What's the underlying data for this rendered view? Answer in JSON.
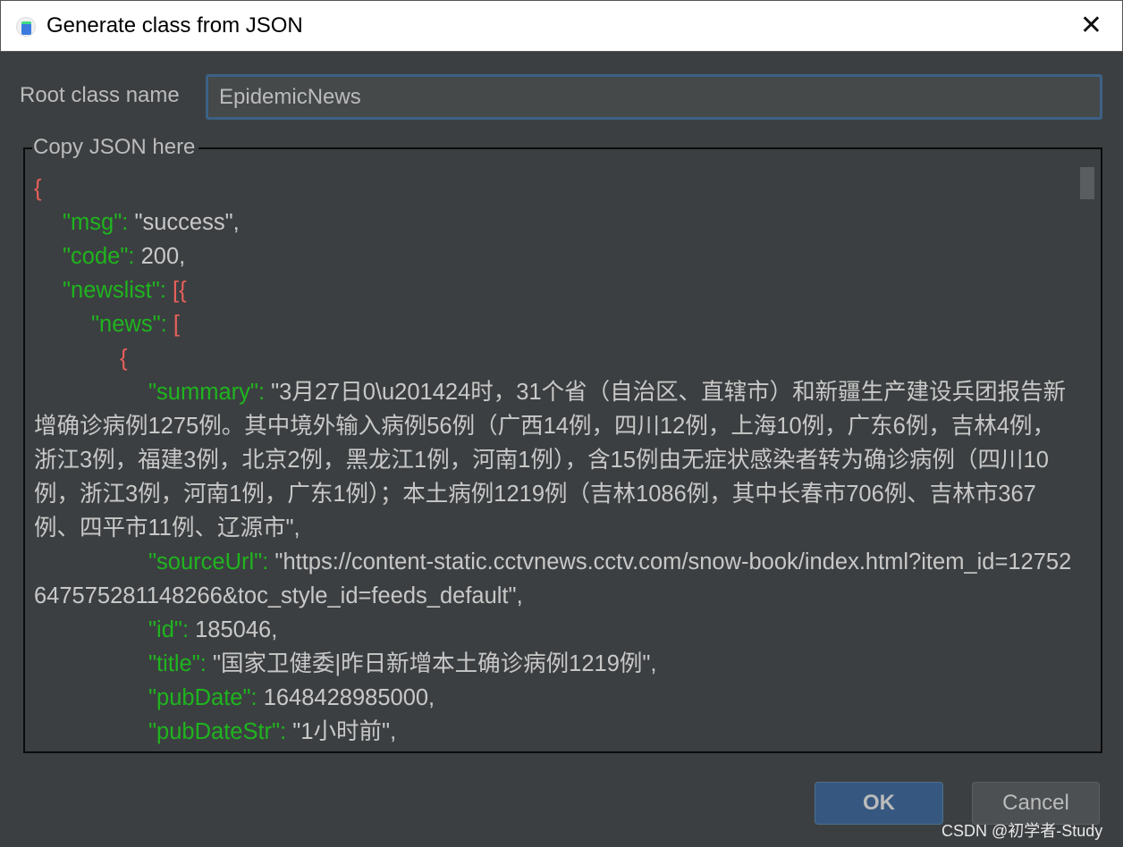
{
  "window": {
    "title": "Generate class from JSON"
  },
  "form": {
    "root_label": "Root class name",
    "root_value": "EpidemicNews",
    "json_label": "Copy JSON here"
  },
  "editor_lines": [
    {
      "indent": 0,
      "tokens": [
        {
          "t": "{",
          "c": "p"
        }
      ]
    },
    {
      "indent": 1,
      "tokens": [
        {
          "t": "\"msg\"",
          "c": "k"
        },
        {
          "t": ": ",
          "c": "k"
        },
        {
          "t": "\"success\",",
          "c": "v"
        }
      ]
    },
    {
      "indent": 1,
      "tokens": [
        {
          "t": "\"code\"",
          "c": "k"
        },
        {
          "t": ": ",
          "c": "k"
        },
        {
          "t": "200,",
          "c": "v"
        }
      ]
    },
    {
      "indent": 1,
      "tokens": [
        {
          "t": "\"newslist\"",
          "c": "k"
        },
        {
          "t": ": ",
          "c": "k"
        },
        {
          "t": "[{",
          "c": "p"
        }
      ]
    },
    {
      "indent": 2,
      "tokens": [
        {
          "t": "\"news\"",
          "c": "k"
        },
        {
          "t": ": ",
          "c": "k"
        },
        {
          "t": "[",
          "c": "p"
        }
      ]
    },
    {
      "indent": 3,
      "tokens": [
        {
          "t": "{",
          "c": "p"
        }
      ]
    },
    {
      "indent": 4,
      "tokens": [
        {
          "t": "\"summary\"",
          "c": "k"
        },
        {
          "t": ": ",
          "c": "k"
        },
        {
          "t": "\"3月27日0\\u201424时，31个省（自治区、直辖市）和新疆生产建设兵团报告新增确诊病例1275例。其中境外输入病例56例（广西14例，四川12例，上海10例，广东6例，吉林4例，浙江3例，福建3例，北京2例，黑龙江1例，河南1例），含15例由无症状感染者转为确诊病例（四川10例，浙江3例，河南1例，广东1例）；本土病例1219例（吉林1086例，其中长春市706例、吉林市367例、四平市11例、辽源市\",",
          "c": "v"
        }
      ]
    },
    {
      "indent": 4,
      "tokens": [
        {
          "t": "\"sourceUrl\"",
          "c": "k"
        },
        {
          "t": ": ",
          "c": "k"
        },
        {
          "t": "\"https://content-static.cctvnews.cctv.com/snow-book/index.html?item_id=12752647575281148266&toc_style_id=feeds_default\",",
          "c": "v"
        }
      ]
    },
    {
      "indent": 4,
      "tokens": [
        {
          "t": "\"id\"",
          "c": "k"
        },
        {
          "t": ": ",
          "c": "k"
        },
        {
          "t": "185046,",
          "c": "v"
        }
      ]
    },
    {
      "indent": 4,
      "tokens": [
        {
          "t": "\"title\"",
          "c": "k"
        },
        {
          "t": ": ",
          "c": "k"
        },
        {
          "t": "\"国家卫健委|昨日新增本土确诊病例1219例\",",
          "c": "v"
        }
      ]
    },
    {
      "indent": 4,
      "tokens": [
        {
          "t": "\"pubDate\"",
          "c": "k"
        },
        {
          "t": ": ",
          "c": "k"
        },
        {
          "t": "1648428985000,",
          "c": "v"
        }
      ]
    },
    {
      "indent": 4,
      "tokens": [
        {
          "t": "\"pubDateStr\"",
          "c": "k"
        },
        {
          "t": ": ",
          "c": "k"
        },
        {
          "t": "\"1小时前\",",
          "c": "v"
        }
      ]
    }
  ],
  "buttons": {
    "ok": "OK",
    "cancel": "Cancel"
  },
  "watermark": "CSDN @初学者-Study"
}
